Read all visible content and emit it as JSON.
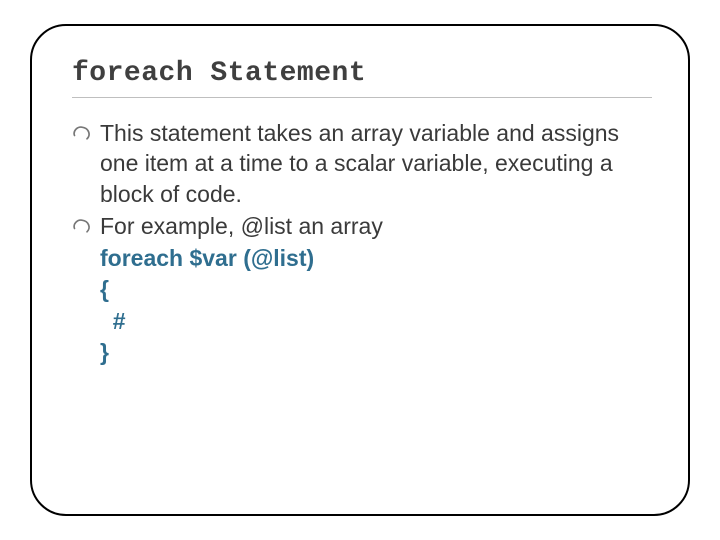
{
  "title": "foreach Statement",
  "bullets": [
    "This statement takes an array variable and assigns one item at a time to a scalar variable, executing a block of code.",
    "For example, @list an array"
  ],
  "code": {
    "l1": "foreach $var (@list)",
    "l2": "{",
    "l3": "  #",
    "l4": "}"
  }
}
